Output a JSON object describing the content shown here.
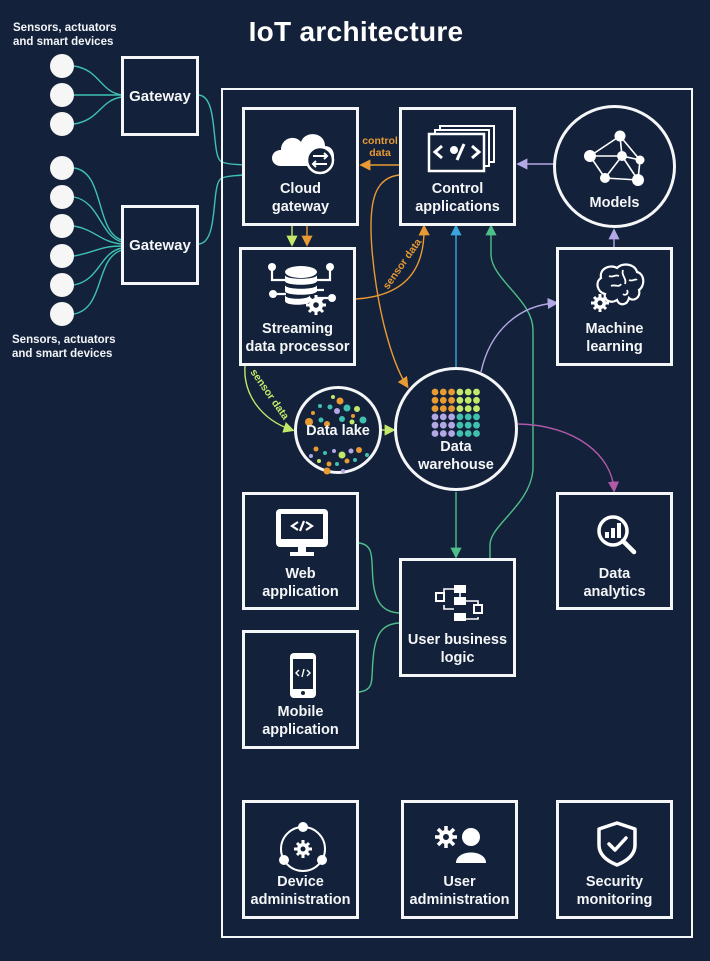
{
  "title": "IoT architecture",
  "colors": {
    "background": "#13213a",
    "stroke": "#f4f6f8",
    "teal": "#3fc1b0",
    "orange": "#e89a33",
    "lime": "#c3e86a",
    "blue": "#3aa6dd",
    "green": "#4fbf8a",
    "lavender": "#b3a8e6",
    "magenta": "#b05aa8"
  },
  "devices": {
    "top_caption_line1": "Sensors, actuators",
    "top_caption_line2": "and smart devices",
    "bottom_caption_line1": "Sensors, actuators",
    "bottom_caption_line2": "and smart devices",
    "top_group_count": 3,
    "bottom_group_count": 6
  },
  "gateways": [
    {
      "label": "Gateway"
    },
    {
      "label": "Gateway"
    }
  ],
  "nodes": {
    "cloud_gateway": {
      "line1": "Cloud",
      "line2": "gateway",
      "icon": "cloud-sync-icon"
    },
    "control_applications": {
      "line1": "Control",
      "line2": "applications",
      "icon": "code-windows-icon"
    },
    "models": {
      "line1": "Models",
      "icon": "network-graph-icon"
    },
    "streaming_data_processor": {
      "line1": "Streaming",
      "line2": "data processor",
      "icon": "database-gear-icon"
    },
    "machine_learning": {
      "line1": "Machine",
      "line2": "learning",
      "icon": "brain-gear-icon"
    },
    "data_lake": {
      "line1": "Data lake",
      "icon": "scattered-dots-icon"
    },
    "data_warehouse": {
      "line1": "Data",
      "line2": "warehouse",
      "icon": "dot-grid-icon"
    },
    "web_application": {
      "line1": "Web",
      "line2": "application",
      "icon": "monitor-code-icon"
    },
    "data_analytics": {
      "line1": "Data",
      "line2": "analytics",
      "icon": "magnifier-chart-icon"
    },
    "user_business_logic": {
      "line1": "User business",
      "line2": "logic",
      "icon": "flowchart-icon"
    },
    "mobile_application": {
      "line1": "Mobile",
      "line2": "application",
      "icon": "phone-code-icon"
    },
    "device_administration": {
      "line1": "Device",
      "line2": "administration",
      "icon": "device-admin-icon"
    },
    "user_administration": {
      "line1": "User",
      "line2": "administration",
      "icon": "user-gear-icon"
    },
    "security_monitoring": {
      "line1": "Security",
      "line2": "monitoring",
      "icon": "shield-check-icon"
    }
  },
  "edge_labels": {
    "control_data_line1": "control",
    "control_data_line2": "data",
    "sensor_data_upper": "sensor data",
    "sensor_data_lower": "sensor data"
  },
  "edges": [
    {
      "from": "devices-top",
      "to": "gateway-1",
      "color": "teal"
    },
    {
      "from": "devices-bottom",
      "to": "gateway-2",
      "color": "teal"
    },
    {
      "from": "gateway-1",
      "to": "cloud_gateway",
      "color": "teal"
    },
    {
      "from": "gateway-2",
      "to": "cloud_gateway",
      "color": "teal"
    },
    {
      "from": "control_applications",
      "to": "cloud_gateway",
      "color": "orange",
      "label": "control data"
    },
    {
      "from": "cloud_gateway",
      "to": "streaming_data_processor",
      "color": "lime"
    },
    {
      "from": "cloud_gateway",
      "to": "streaming_data_processor",
      "color": "orange"
    },
    {
      "from": "streaming_data_processor",
      "to": "control_applications",
      "color": "orange",
      "label": "sensor data"
    },
    {
      "from": "control_applications",
      "to": "data_warehouse",
      "color": "orange"
    },
    {
      "from": "streaming_data_processor",
      "to": "data_lake",
      "color": "lime",
      "label": "sensor data"
    },
    {
      "from": "data_lake",
      "to": "data_warehouse",
      "color": "lime"
    },
    {
      "from": "data_warehouse",
      "to": "control_applications",
      "color": "blue"
    },
    {
      "from": "user_business_logic",
      "to": "control_applications",
      "color": "green"
    },
    {
      "from": "data_warehouse",
      "to": "machine_learning",
      "color": "lavender"
    },
    {
      "from": "machine_learning",
      "to": "models",
      "color": "lavender"
    },
    {
      "from": "models",
      "to": "control_applications",
      "color": "lavender"
    },
    {
      "from": "data_warehouse",
      "to": "data_analytics",
      "color": "magenta"
    },
    {
      "from": "data_warehouse",
      "to": "user_business_logic",
      "color": "green"
    },
    {
      "from": "web_application",
      "to": "user_business_logic",
      "color": "green"
    },
    {
      "from": "mobile_application",
      "to": "user_business_logic",
      "color": "green"
    }
  ]
}
